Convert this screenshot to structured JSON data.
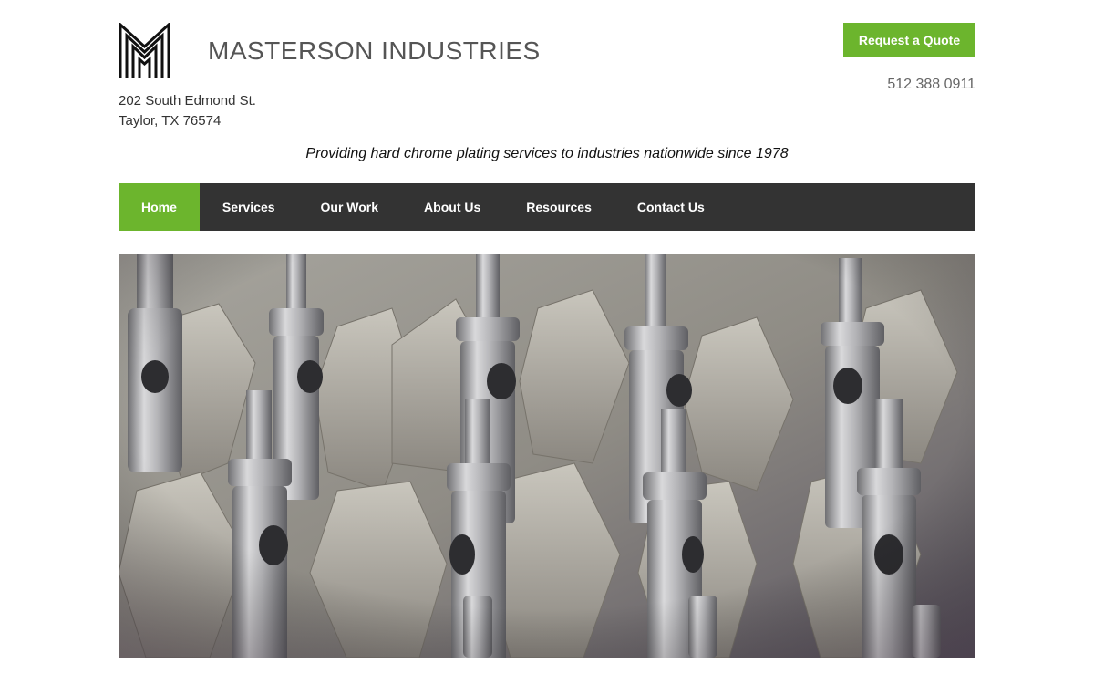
{
  "header": {
    "brand": "MASTERSON INDUSTRIES",
    "logo_icon": "mm-monogram-logo",
    "address_line1": "202 South Edmond St.",
    "address_line2": "Taylor, TX 76574",
    "quote_button": "Request a Quote",
    "phone": "512 388 0911",
    "tagline": "Providing hard chrome plating services to industries nationwide since 1978"
  },
  "nav": {
    "items": [
      {
        "label": "Home",
        "active": true
      },
      {
        "label": "Services"
      },
      {
        "label": "Our Work"
      },
      {
        "label": "About Us"
      },
      {
        "label": "Resources"
      },
      {
        "label": "Contact Us"
      }
    ]
  },
  "colors": {
    "accent": "#6cb52d",
    "nav_bg": "#333333",
    "brand_text": "#555555"
  },
  "hero": {
    "image_subject": "chrome-plated-cylindrical-parts-photo"
  }
}
